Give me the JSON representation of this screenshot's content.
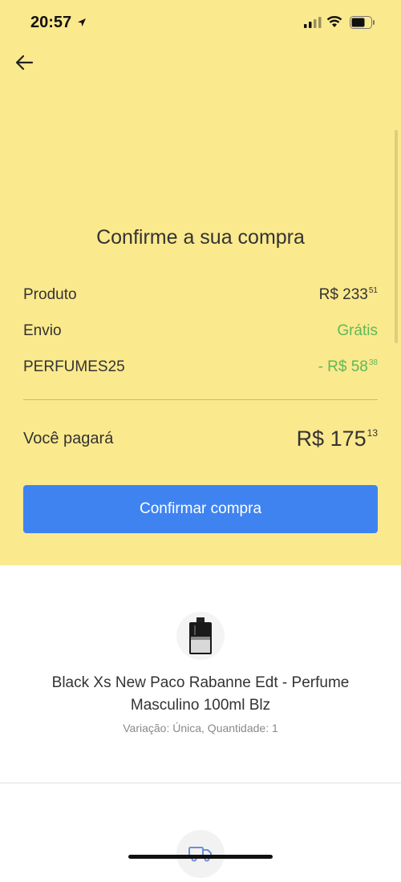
{
  "status_bar": {
    "time": "20:57"
  },
  "page": {
    "title": "Confirme a sua compra"
  },
  "summary": {
    "product_label": "Produto",
    "product_value": "R$ 233",
    "product_cents": "51",
    "shipping_label": "Envio",
    "shipping_value": "Grátis",
    "coupon_label": "PERFUMES25",
    "coupon_value": "- R$ 58",
    "coupon_cents": "38",
    "total_label": "Você pagará",
    "total_value": "R$ 175",
    "total_cents": "13"
  },
  "actions": {
    "confirm_label": "Confirmar compra"
  },
  "product": {
    "name": "Black Xs New Paco Rabanne Edt - Perfume Masculino 100ml Blz",
    "variant": "Variação: Única, Quantidade: 1"
  },
  "colors": {
    "header_bg": "#fbe98d",
    "accent_blue": "#3f83f1",
    "green": "#5fb85a"
  }
}
